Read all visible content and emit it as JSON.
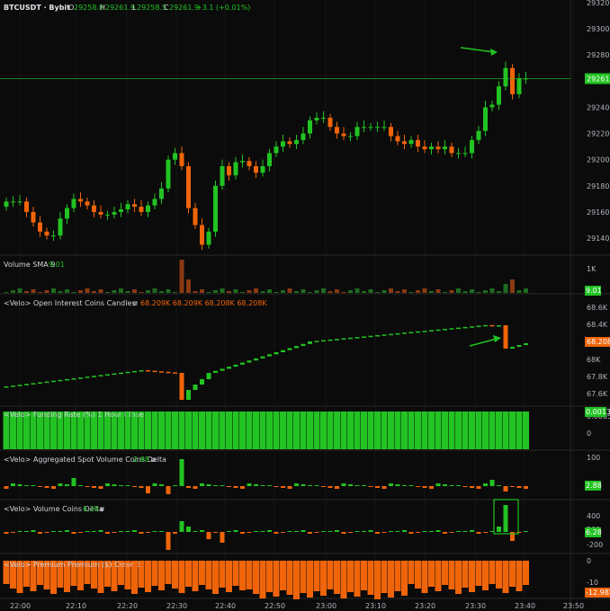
{
  "header": {
    "symbol": "BTCUSDT · Bybit",
    "o_label": "O",
    "o_value": "29258.8",
    "h_label": "H",
    "h_value": "29261.9",
    "l_label": "L",
    "l_value": "29258.5",
    "c_label": "C",
    "c_value": "29261.9",
    "change": "+3.1 (+0.01%)"
  },
  "colors": {
    "up": "#22c322",
    "down": "#f0640a",
    "bg": "#0b0b0b",
    "grid": "#1e1e1e",
    "axis_bg": "#0b0b0b"
  },
  "time_axis": {
    "labels": [
      "22:00",
      "22:10",
      "22:20",
      "22:30",
      "22:40",
      "22:50",
      "23:00",
      "23:10",
      "23:20",
      "23:30",
      "23:40",
      "23:50"
    ]
  },
  "chart_data": [
    {
      "type": "candlestick",
      "name": "price",
      "y_ticks": [
        "29320.0",
        "29300.0",
        "29280.0",
        "29260.0",
        "29240.0",
        "29220.0",
        "29200.0",
        "29180.0",
        "29160.0",
        "29140.0"
      ],
      "ylim": [
        29127,
        29322
      ],
      "last_price": "29261.9",
      "candles_close": [
        29168,
        29168,
        29168,
        29160,
        29152,
        29145,
        29142,
        29142,
        29155,
        29163,
        29170,
        29168,
        29165,
        29160,
        29158,
        29158,
        29160,
        29162,
        29166,
        29164,
        29160,
        29165,
        29170,
        29178,
        29200,
        29205,
        29195,
        29163,
        29150,
        29135,
        29145,
        29180,
        29195,
        29188,
        29198,
        29199,
        29195,
        29190,
        29195,
        29205,
        29210,
        29214,
        29212,
        29215,
        29220,
        29230,
        29232,
        29232,
        29225,
        29220,
        29218,
        29218,
        29225,
        29225,
        29225,
        29225,
        29225,
        29218,
        29214,
        29212,
        29215,
        29210,
        29208,
        29210,
        29208,
        29210,
        29205,
        29205,
        29205,
        29215,
        29222,
        29240,
        29242,
        29256,
        29270,
        29250,
        29262,
        29262
      ]
    },
    {
      "type": "bar",
      "name": "volume",
      "title": "Volume SMA 9",
      "value_label": "9.01",
      "y_ticks": [
        "1K"
      ]
    },
    {
      "type": "candlestick",
      "name": "open_interest",
      "title": "<Velo> Open Interest Coins Candles",
      "symbol": "ø",
      "values_label": "68.209K 68.209K 68.208K 68.208K",
      "y_ticks": [
        "68.6K",
        "68.4K",
        "68.2K",
        "68K",
        "67.8K",
        "67.6K"
      ],
      "last_value": "68.208K"
    },
    {
      "type": "bar",
      "name": "funding_rate",
      "title": "<Velo> Funding Rate (%) 1 Hour Close",
      "value_label": "0.0013",
      "y_ticks": [
        "0.001",
        "0.0005",
        "0"
      ],
      "value": 0.0013
    },
    {
      "type": "bar",
      "name": "spot_delta",
      "title": "<Velo> Aggregated Spot Volume Coins Delta",
      "value_label": "2.88",
      "symbol": "ø",
      "y_ticks": [
        "100",
        "0"
      ],
      "last_value": "2.88"
    },
    {
      "type": "bar",
      "name": "volume_delta",
      "title": "<Velo> Volume Coins Delta",
      "value_label": "6.28",
      "symbol": "ø",
      "y_ticks": [
        "400",
        "200",
        "0",
        "-200"
      ],
      "last_value": "6.28"
    },
    {
      "type": "bar",
      "name": "premium",
      "title": "<Velo> Premium Premium ($) Close 1",
      "value_label": "-12.982",
      "y_ticks": [
        "0",
        "-10"
      ],
      "last_value": "-12.982"
    }
  ]
}
